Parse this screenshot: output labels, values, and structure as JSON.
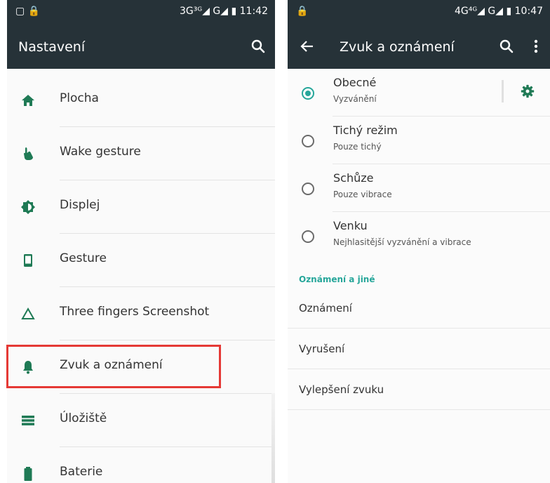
{
  "left": {
    "status": {
      "left_icons": "▢ 🔒",
      "right": "3G³ᴳ◢ G◢ ▮ 11:42"
    },
    "appbar": {
      "title": "Nastavení",
      "icon": "search-icon"
    },
    "items": [
      {
        "label": "Plocha",
        "icon": "home-icon"
      },
      {
        "label": "Wake gesture",
        "icon": "hand-gesture-icon"
      },
      {
        "label": "Displej",
        "icon": "brightness-icon"
      },
      {
        "label": "Gesture",
        "icon": "phone-icon"
      },
      {
        "label": "Three fingers Screenshot",
        "icon": "triangle-icon"
      },
      {
        "label": "Zvuk a oznámení",
        "icon": "bell-icon"
      },
      {
        "label": "Úložiště",
        "icon": "storage-icon"
      },
      {
        "label": "Baterie",
        "icon": "battery-icon"
      }
    ],
    "highlighted_item": "Zvuk a oznámení",
    "highlight_color": "#e53935"
  },
  "right": {
    "status": {
      "left_icons": "🔒",
      "right": "4G⁴ᴳ◢ G◢ ▮ 10:47"
    },
    "appbar": {
      "title": "Zvuk a oznámení",
      "icons": [
        "back-arrow-icon",
        "search-icon",
        "more-vert-icon"
      ]
    },
    "modes": [
      {
        "title": "Obecné",
        "subtitle": "Vyzvánění",
        "selected": true
      },
      {
        "title": "Tichý režim",
        "subtitle": "Pouze tichý",
        "selected": false
      },
      {
        "title": "Schůze",
        "subtitle": "Pouze vibrace",
        "selected": false
      },
      {
        "title": "Venku",
        "subtitle": "Nejhlasitější vyzvánění a vibrace",
        "selected": false
      }
    ],
    "section_header": "Oznámení a jiné",
    "items": [
      {
        "label": "Oznámení"
      },
      {
        "label": "Vyrušení"
      },
      {
        "label": "Vylepšení zvuku"
      }
    ],
    "accent": "#26a69a",
    "bar_color": "#263238"
  }
}
